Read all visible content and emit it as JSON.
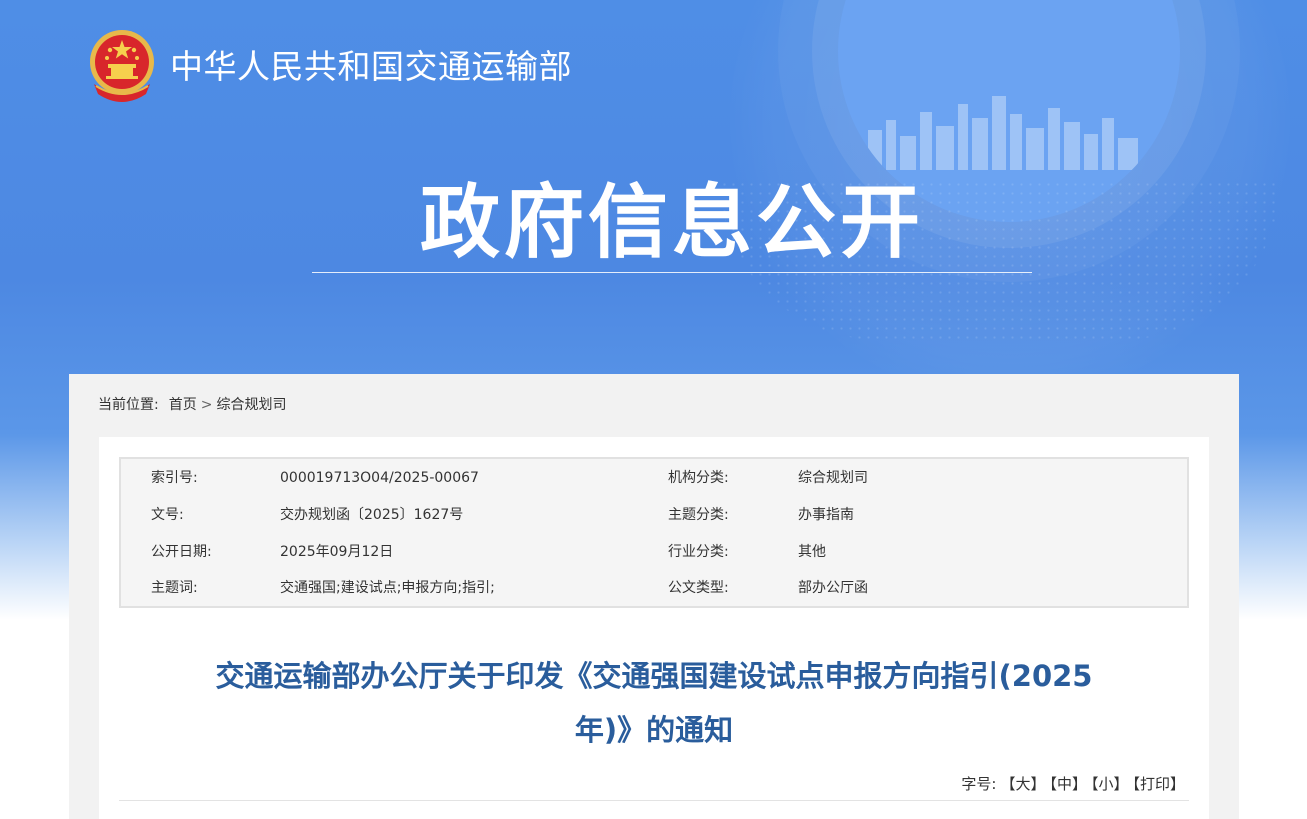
{
  "site": {
    "name": "中华人民共和国交通运输部",
    "section_title": "政府信息公开"
  },
  "breadcrumb": {
    "label": "当前位置:",
    "home": "首页",
    "separator": ">",
    "current": "综合规划司"
  },
  "meta": {
    "rows": [
      {
        "k1": "索引号:",
        "v1": "000019713O04/2025-00067",
        "k2": "机构分类:",
        "v2": "综合规划司"
      },
      {
        "k1": "文号:",
        "v1": "交办规划函〔2025〕1627号",
        "k2": "主题分类:",
        "v2": "办事指南"
      },
      {
        "k1": "公开日期:",
        "v1": "2025年09月12日",
        "k2": "行业分类:",
        "v2": "其他"
      },
      {
        "k1": "主题词:",
        "v1": "交通强国;建设试点;申报方向;指引;",
        "k2": "公文类型:",
        "v2": "部办公厅函"
      }
    ]
  },
  "document": {
    "title_line1": "交通运输部办公厅关于印发《交通强国建设试点申报方向指引(2025",
    "title_line2": "年)》的通知"
  },
  "font_tools": {
    "label": "字号:",
    "large": "【大】",
    "medium": "【中】",
    "small": "【小】",
    "print": "【打印】"
  },
  "colors": {
    "hero_blue": "#4f8ee6",
    "title_blue": "#2a5d9c",
    "content_bg": "#f2f2f2"
  },
  "icons": {
    "emblem": "national-emblem-icon"
  }
}
